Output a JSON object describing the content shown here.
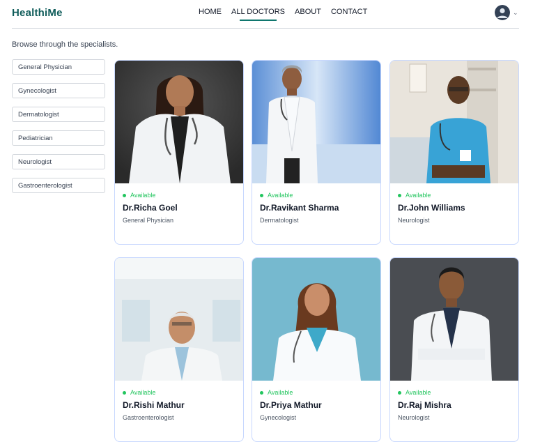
{
  "app": {
    "logo": "HealthiMe"
  },
  "nav": {
    "items": [
      {
        "label": "HOME"
      },
      {
        "label": "ALL DOCTORS"
      },
      {
        "label": "ABOUT"
      },
      {
        "label": "CONTACT"
      }
    ],
    "active_index": 1
  },
  "page": {
    "subtitle": "Browse through the specialists."
  },
  "sidebar": {
    "items": [
      {
        "label": "General Physician"
      },
      {
        "label": "Gynecologist"
      },
      {
        "label": "Dermatologist"
      },
      {
        "label": "Pediatrician"
      },
      {
        "label": "Neurologist"
      },
      {
        "label": "Gastroenterologist"
      }
    ]
  },
  "doctors": [
    {
      "status": "Available",
      "name": "Dr.Richa Goel",
      "speciality": "General Physician"
    },
    {
      "status": "Available",
      "name": "Dr.Ravikant Sharma",
      "speciality": "Dermatologist"
    },
    {
      "status": "Available",
      "name": "Dr.John Williams",
      "speciality": "Neurologist"
    },
    {
      "status": "Available",
      "name": "Dr.Rishi Mathur",
      "speciality": "Gastroenterologist"
    },
    {
      "status": "Available",
      "name": "Dr.Priya Mathur",
      "speciality": "Gynecologist"
    },
    {
      "status": "Available",
      "name": "Dr.Raj Mishra",
      "speciality": "Neurologist"
    }
  ],
  "colors": {
    "brand": "#0f5c5a",
    "available": "#22c55e",
    "card_border": "#c7d7fe"
  }
}
